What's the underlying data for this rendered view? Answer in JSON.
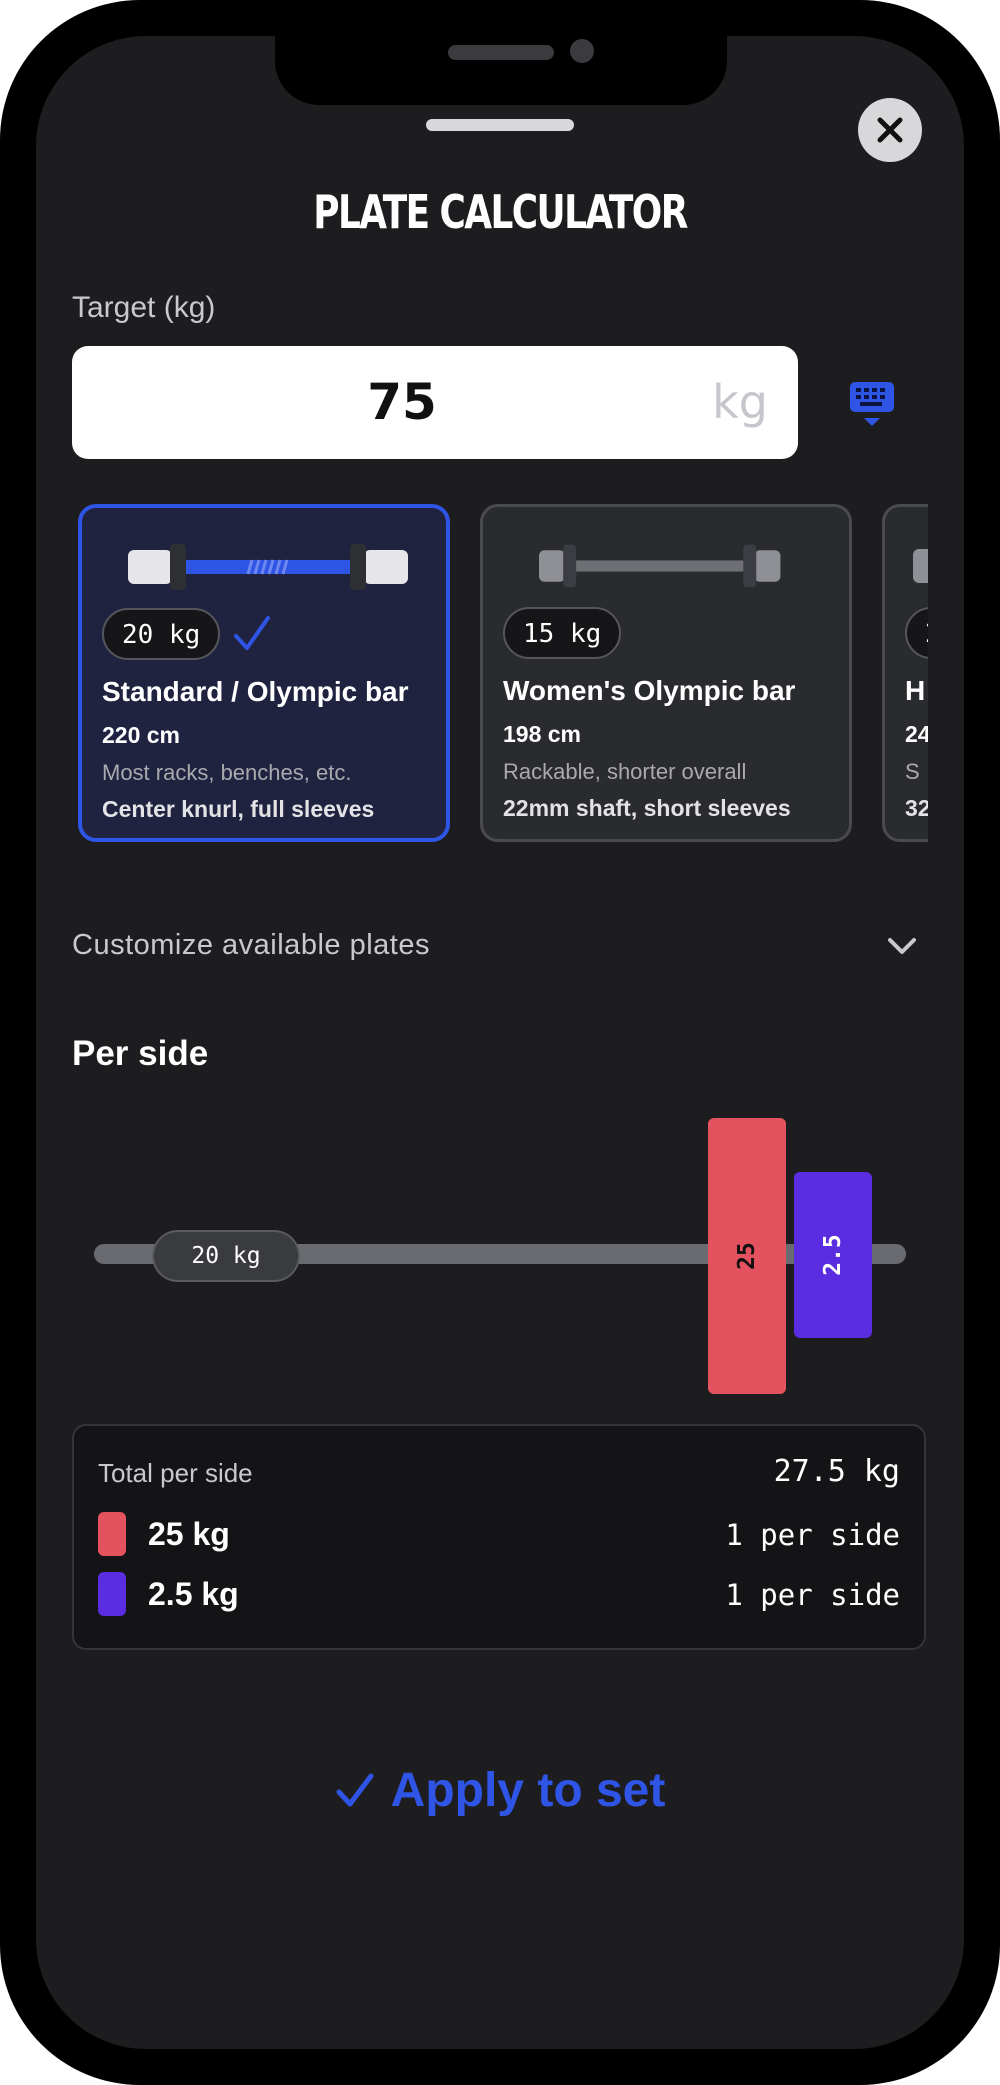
{
  "title": "PLATE CALCULATOR",
  "target": {
    "label": "Target (kg)",
    "value": "75",
    "unit": "kg"
  },
  "bars": [
    {
      "weight": "20 kg",
      "name": "Standard / Olympic bar",
      "length": "220 cm",
      "note": "Most racks, benches, etc.",
      "feature": "Center knurl, full sleeves",
      "selected": true
    },
    {
      "weight": "15 kg",
      "name": "Women's Olympic bar",
      "length": "198 cm",
      "note": "Rackable, shorter overall",
      "feature": "22mm shaft, short sleeves",
      "selected": false
    },
    {
      "weight": "2",
      "name": "H",
      "length": "24",
      "note": "S",
      "feature": "32",
      "selected": false
    }
  ],
  "customize_label": "Customize available plates",
  "per_side_label": "Per side",
  "visual": {
    "bar_weight": "20 kg",
    "plates": [
      {
        "label": "25",
        "color": "#e5525f"
      },
      {
        "label": "2.5",
        "color": "#5a2ee0"
      }
    ]
  },
  "summary": {
    "total_label": "Total per side",
    "total_value": "27.5 kg",
    "rows": [
      {
        "plate": "25 kg",
        "count": "1 per side",
        "color": "#e5525f"
      },
      {
        "plate": "2.5 kg",
        "count": "1 per side",
        "color": "#5a2ee0"
      }
    ]
  },
  "apply_label": "Apply to set",
  "colors": {
    "accent": "#2f55e6",
    "background": "#1d1d20"
  },
  "icons": {
    "close": "close-icon",
    "keyboard": "keyboard-icon",
    "check": "check-icon",
    "chevron": "chevron-down-icon"
  }
}
